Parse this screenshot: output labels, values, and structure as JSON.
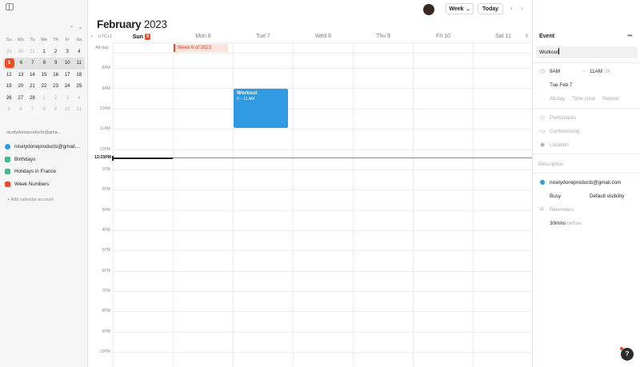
{
  "sidebar": {
    "mini_calendar": {
      "weekdays": [
        "Su",
        "Mo",
        "Tu",
        "We",
        "Th",
        "Fr",
        "Sa"
      ],
      "weeks": [
        [
          "29",
          "30",
          "31",
          "1",
          "2",
          "3",
          "4"
        ],
        [
          "5",
          "6",
          "7",
          "8",
          "9",
          "10",
          "11"
        ],
        [
          "12",
          "13",
          "14",
          "15",
          "16",
          "17",
          "18"
        ],
        [
          "19",
          "20",
          "21",
          "22",
          "23",
          "24",
          "25"
        ],
        [
          "26",
          "27",
          "28",
          "1",
          "2",
          "3",
          "4"
        ],
        [
          "5",
          "6",
          "7",
          "8",
          "9",
          "10",
          "11"
        ]
      ],
      "today": "5"
    },
    "account_title": "nicelydoneproducts@gma...",
    "calendars": [
      {
        "label": "nicelydoneproducts@gmail....",
        "color": "#2f9ae1"
      },
      {
        "label": "Birthdays",
        "color": "#46b88a"
      },
      {
        "label": "Holidays in France",
        "color": "#46b88a"
      },
      {
        "label": "Week Numbers",
        "color": "#ee4a24"
      }
    ],
    "add_account": "+ Add calendar account"
  },
  "header": {
    "month": "February",
    "year": "2023",
    "view": "Week",
    "today_label": "Today"
  },
  "week": {
    "timezone": "UTC+1",
    "days": [
      {
        "label": "Sun",
        "badge": "5"
      },
      {
        "label": "Mon 6"
      },
      {
        "label": "Tue 7"
      },
      {
        "label": "Wed 8"
      },
      {
        "label": "Thu 9"
      },
      {
        "label": "Fri 10"
      },
      {
        "label": "Sat 11"
      }
    ],
    "allday_label": "All-day",
    "week_chip": "Week 6 of 2023",
    "hours": [
      "8AM",
      "9AM",
      "10AM",
      "11AM",
      "12PM",
      "1PM",
      "2PM",
      "3PM",
      "4PM",
      "5PM",
      "6PM",
      "7PM",
      "8PM",
      "9PM",
      "10PM"
    ],
    "now_label": "12:25PM"
  },
  "event": {
    "title": "Workout",
    "time": "9 – 11 AM",
    "color": "#2f9ae1"
  },
  "panel": {
    "title": "Event",
    "event_title": "Workout",
    "start_time": "9AM",
    "end_time": "11AM",
    "duration": "2h",
    "date": "Tue Feb 7",
    "options": [
      "All-day",
      "Time zone",
      "Repeat"
    ],
    "participants": "Participants",
    "conferencing": "Conferencing",
    "location": "Location",
    "description": "Description",
    "calendar": "nicelydoneproducts@gmail.com",
    "availability": "Busy",
    "visibility": "Default visibility",
    "reminders": "Reminders",
    "reminder_value": "30mins",
    "reminder_suffix": "before"
  },
  "help_label": "?"
}
